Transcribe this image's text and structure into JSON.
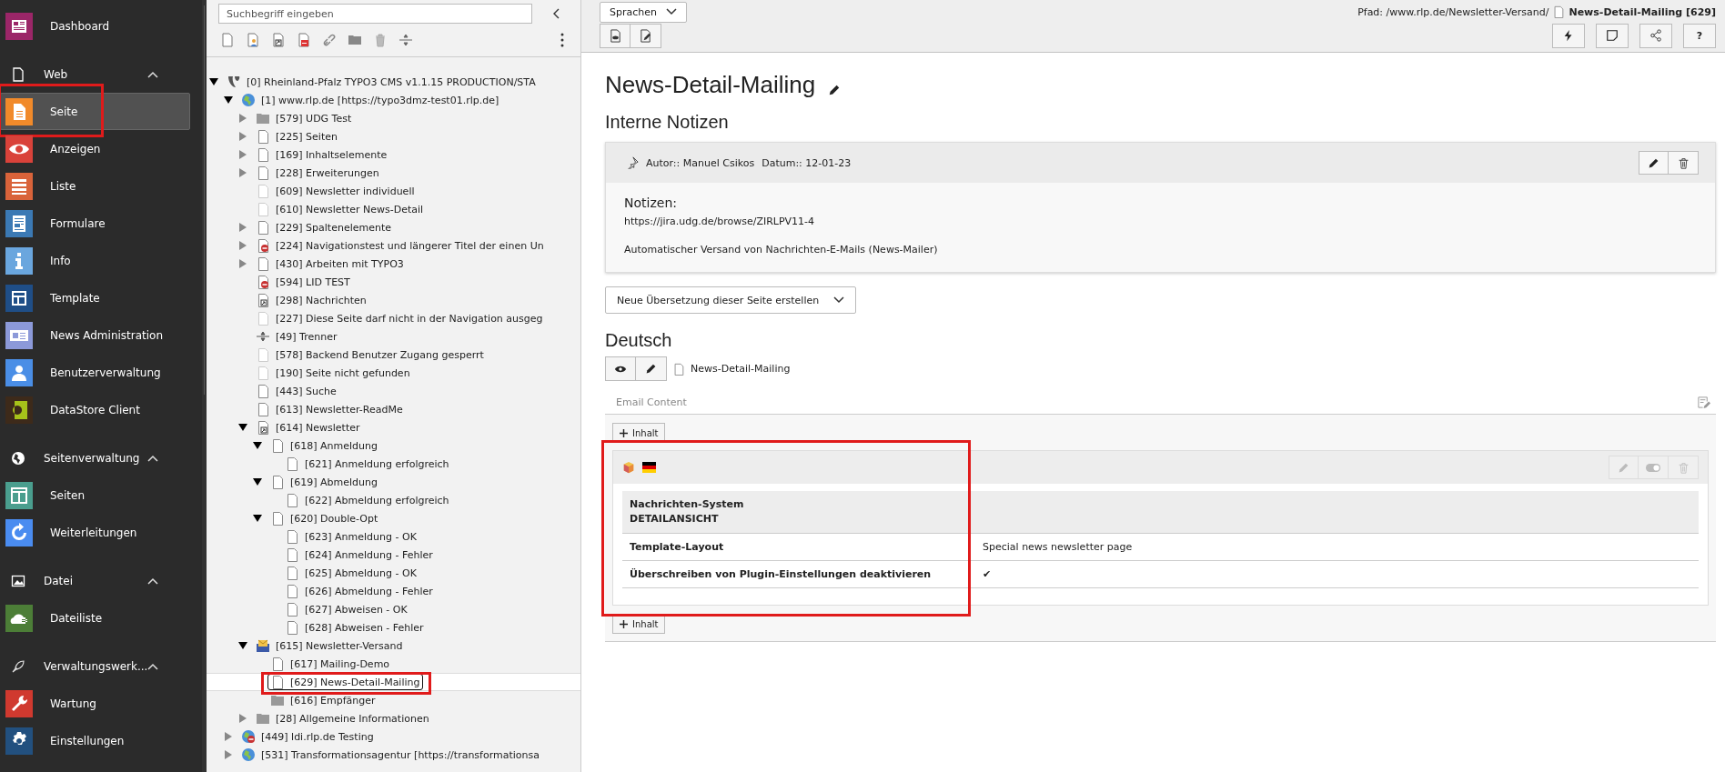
{
  "sidebar": {
    "sections": [
      {
        "items": [
          {
            "label": "Dashboard",
            "kind": "dashboard",
            "color": "#9b2668",
            "selected": false,
            "marked": false
          }
        ]
      },
      {
        "header": {
          "label": "Web",
          "kind": "page",
          "expanded": true
        },
        "items": [
          {
            "label": "Seite",
            "kind": "page",
            "color": "#f18a2a",
            "selected": true,
            "marked": true
          },
          {
            "label": "Anzeigen",
            "kind": "eye",
            "color": "#d9423a",
            "selected": false,
            "marked": false
          },
          {
            "label": "Liste",
            "kind": "list",
            "color": "#d9633a",
            "selected": false,
            "marked": false
          },
          {
            "label": "Formulare",
            "kind": "form",
            "color": "#3b79b4",
            "selected": false,
            "marked": false
          },
          {
            "label": "Info",
            "kind": "info",
            "color": "#6aa6de",
            "selected": false,
            "marked": false
          },
          {
            "label": "Template",
            "kind": "template",
            "color": "#1f4e87",
            "selected": false,
            "marked": false
          },
          {
            "label": "News Administration",
            "kind": "news",
            "color": "#8c99d9",
            "selected": false,
            "marked": false
          },
          {
            "label": "Benutzerverwaltung",
            "kind": "user",
            "color": "#4a8ee6",
            "selected": false,
            "marked": false
          },
          {
            "label": "DataStore Client",
            "kind": "datastore",
            "color": "#3d2a1a",
            "selected": false,
            "marked": false
          }
        ]
      },
      {
        "header": {
          "label": "Seitenverwaltung",
          "kind": "globe",
          "expanded": true
        },
        "items": [
          {
            "label": "Seiten",
            "kind": "pages",
            "color": "#4a9e8e",
            "selected": false,
            "marked": false
          },
          {
            "label": "Weiterleitungen",
            "kind": "redirect",
            "color": "#4a8cf0",
            "selected": false,
            "marked": false
          }
        ]
      },
      {
        "header": {
          "label": "Datei",
          "kind": "image",
          "expanded": true
        },
        "items": [
          {
            "label": "Dateiliste",
            "kind": "cloud",
            "color": "#4c7e37",
            "selected": false,
            "marked": false
          }
        ]
      },
      {
        "header": {
          "label": "Verwaltungswerk...",
          "kind": "rocket",
          "expanded": true
        },
        "items": [
          {
            "label": "Wartung",
            "kind": "wrench",
            "color": "#d0392f",
            "selected": false,
            "marked": false
          },
          {
            "label": "Einstellungen",
            "kind": "gear",
            "color": "#22507f",
            "selected": false,
            "marked": false
          }
        ]
      }
    ]
  },
  "tree_search": {
    "placeholder": "Suchbegriff eingeben"
  },
  "tree": [
    {
      "label": "[0] Rheinland-Pfalz TYPO3 CMS v1.1.15 PRODUCTION/STA",
      "kind": "root",
      "expanded": true,
      "selected": false,
      "children": [
        {
          "label": "[1] www.rlp.de [https://typo3dmz-test01.rlp.de]",
          "kind": "site",
          "expanded": true,
          "selected": false,
          "children": [
            {
              "label": "[579] UDG Test",
              "kind": "folder",
              "expanded": false,
              "selected": false
            },
            {
              "label": "[225] Seiten",
              "kind": "page",
              "expanded": false,
              "selected": false
            },
            {
              "label": "[169] Inhaltselemente",
              "kind": "page",
              "expanded": false,
              "selected": false
            },
            {
              "label": "[228] Erweiterungen",
              "kind": "page",
              "expanded": false,
              "selected": false
            },
            {
              "label": "[609] Newsletter individuell",
              "kind": "page-dim",
              "selected": false
            },
            {
              "label": "[610] Newsletter News-Detail",
              "kind": "page-dim",
              "selected": false
            },
            {
              "label": "[229] Spaltenelemente",
              "kind": "page",
              "expanded": false,
              "selected": false
            },
            {
              "label": "[224] Navigationstest und längerer Titel der einen Un",
              "kind": "page-hidden",
              "expanded": false,
              "selected": false
            },
            {
              "label": "[430] Arbeiten mit TYPO3",
              "kind": "page",
              "expanded": false,
              "selected": false
            },
            {
              "label": "[594] LID TEST",
              "kind": "page-hidden",
              "selected": false
            },
            {
              "label": "[298] Nachrichten",
              "kind": "shortcut",
              "selected": false
            },
            {
              "label": "[227] Diese Seite darf nicht in der Navigation ausgeg",
              "kind": "page-dim",
              "selected": false
            },
            {
              "label": "[49] Trenner",
              "kind": "separator",
              "selected": false
            },
            {
              "label": "[578] Backend Benutzer Zugang gesperrt",
              "kind": "page-dim",
              "selected": false
            },
            {
              "label": "[190] Seite nicht gefunden",
              "kind": "page-dim",
              "selected": false
            },
            {
              "label": "[443] Suche",
              "kind": "page",
              "selected": false
            },
            {
              "label": "[613] Newsletter-ReadMe",
              "kind": "page",
              "selected": false
            },
            {
              "label": "[614] Newsletter",
              "kind": "shortcut",
              "expanded": true,
              "selected": false,
              "children": [
                {
                  "label": "[618] Anmeldung",
                  "kind": "page",
                  "expanded": true,
                  "selected": false,
                  "children": [
                    {
                      "label": "[621] Anmeldung erfolgreich",
                      "kind": "page",
                      "selected": false
                    }
                  ]
                },
                {
                  "label": "[619] Abmeldung",
                  "kind": "page",
                  "expanded": true,
                  "selected": false,
                  "children": [
                    {
                      "label": "[622] Abmeldung erfolgreich",
                      "kind": "page",
                      "selected": false
                    }
                  ]
                },
                {
                  "label": "[620] Double-Opt",
                  "kind": "page",
                  "expanded": true,
                  "selected": false,
                  "children": [
                    {
                      "label": "[623] Anmeldung - OK",
                      "kind": "page",
                      "selected": false
                    },
                    {
                      "label": "[624] Anmeldung - Fehler",
                      "kind": "page",
                      "selected": false
                    },
                    {
                      "label": "[625] Abmeldung - OK",
                      "kind": "page",
                      "selected": false
                    },
                    {
                      "label": "[626] Abmeldung - Fehler",
                      "kind": "page",
                      "selected": false
                    },
                    {
                      "label": "[627] Abweisen - OK",
                      "kind": "page",
                      "selected": false
                    },
                    {
                      "label": "[628] Abweisen - Fehler",
                      "kind": "page",
                      "selected": false
                    }
                  ]
                }
              ]
            },
            {
              "label": "[615] Newsletter-Versand",
              "kind": "mail",
              "expanded": true,
              "selected": false,
              "children": [
                {
                  "label": "[617] Mailing-Demo",
                  "kind": "page",
                  "selected": false
                },
                {
                  "label": "[629] News-Detail-Mailing",
                  "kind": "page",
                  "selected": true,
                  "marked": true
                },
                {
                  "label": "[616] Empfänger",
                  "kind": "folder",
                  "selected": false
                }
              ]
            },
            {
              "label": "[28] Allgemeine Informationen",
              "kind": "folder",
              "expanded": false,
              "selected": false
            }
          ]
        },
        {
          "label": "[449] ldi.rlp.de Testing",
          "kind": "site-hidden",
          "expanded": false,
          "selected": false
        },
        {
          "label": "[531] Transformationsagentur [https://transformationsa",
          "kind": "site",
          "expanded": false,
          "selected": false
        }
      ]
    }
  ],
  "docheader": {
    "language_menu": "Sprachen",
    "path_label": "Pfad: /www.rlp.de/Newsletter-Versand/",
    "page_title": "News-Detail-Mailing [629]",
    "help": "?"
  },
  "page": {
    "title": "News-Detail-Mailing",
    "notes_heading": "Interne Notizen",
    "note": {
      "author": "Autor:: Manuel Csikos",
      "date": "Datum:: 12-01-23",
      "heading": "Notizen:",
      "link": "https://jira.udg.de/browse/ZIRLPV11-4",
      "text": "Automatischer Versand von Nachrichten-E-Mails (News-Mailer)"
    },
    "translation_menu": "Neue Übersetzung dieser Seite erstellen",
    "language": "Deutsch",
    "language_page": "News-Detail-Mailing",
    "column": {
      "title": "Email Content",
      "add_buttons": [
        "Inhalt",
        "Inhalt"
      ],
      "element": {
        "marked": true,
        "header_lines": [
          "Nachrichten-System",
          "DETAILANSICHT"
        ],
        "rows": [
          {
            "label": "Template-Layout",
            "value": "Special news newsletter page"
          },
          {
            "label": "Überschreiben von Plugin-Einstellungen deaktivieren",
            "value": "✔"
          }
        ]
      }
    }
  }
}
